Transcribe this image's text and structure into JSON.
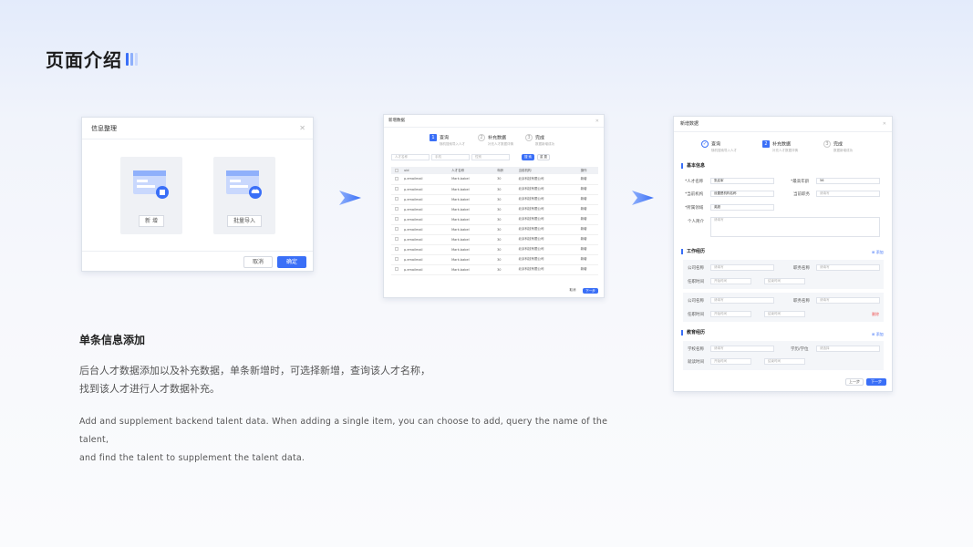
{
  "page": {
    "title": "页面介绍",
    "subtitle": "单条信息添加",
    "desc_cn_1": "后台人才数据添加以及补充数据，单条新增时，可选择新增，查询该人才名称，",
    "desc_cn_2": "找到该人才进行人才数据补充。",
    "desc_en_1": "Add and supplement backend talent data. When adding a single item, you can choose to add, query the name of the talent,",
    "desc_en_2": "and find the talent to supplement the talent data."
  },
  "colors": {
    "accent": "#3a6ff7",
    "bar1": "#3a6ff7",
    "bar2": "#8fb0fb",
    "bar3": "#c9d8fd"
  },
  "dialog1": {
    "title": "信息整理",
    "add_label": "新 增",
    "batch_label": "批量导入",
    "cancel": "取消",
    "confirm": "确定"
  },
  "dialog2": {
    "title": "新增数据",
    "steps": [
      {
        "num": "1",
        "label": "查询",
        "sub": "随机搜索导入人才"
      },
      {
        "num": "2",
        "label": "补充数据",
        "sub": "补充人才数据详情"
      },
      {
        "num": "3",
        "label": "完成",
        "sub": "数据新增成功"
      }
    ],
    "search_placeholders": [
      "人才名称",
      "手机",
      "性别"
    ],
    "search_btn": "搜 索",
    "reset_btn": "重 置",
    "columns": [
      "uid",
      "人才名称",
      "年龄",
      "当前机构",
      "操作"
    ],
    "rows": [
      {
        "uid": "p.emailmail",
        "name": "Mark.babel",
        "age": "30",
        "org": "北京科技有限公司",
        "op": "新增"
      },
      {
        "uid": "p.emailmail",
        "name": "Mark.babel",
        "age": "30",
        "org": "北京科技有限公司",
        "op": "新增"
      },
      {
        "uid": "p.emailmail",
        "name": "Mark.babel",
        "age": "30",
        "org": "北京科技有限公司",
        "op": "新增"
      },
      {
        "uid": "p.emailmail",
        "name": "Mark.babel",
        "age": "30",
        "org": "北京科技有限公司",
        "op": "新增"
      },
      {
        "uid": "p.emailmail",
        "name": "Mark.babel",
        "age": "30",
        "org": "北京科技有限公司",
        "op": "新增"
      },
      {
        "uid": "p.emailmail",
        "name": "Mark.babel",
        "age": "30",
        "org": "北京科技有限公司",
        "op": "新增"
      },
      {
        "uid": "p.emailmail",
        "name": "Mark.babel",
        "age": "30",
        "org": "北京科技有限公司",
        "op": "新增"
      },
      {
        "uid": "p.emailmail",
        "name": "Mark.babel",
        "age": "30",
        "org": "北京科技有限公司",
        "op": "新增"
      },
      {
        "uid": "p.emailmail",
        "name": "Mark.babel",
        "age": "30",
        "org": "北京科技有限公司",
        "op": "新增"
      },
      {
        "uid": "p.emailmail",
        "name": "Mark.babel",
        "age": "30",
        "org": "北京科技有限公司",
        "op": "新增"
      }
    ],
    "cancel": "取消",
    "next": "下一步"
  },
  "dialog3": {
    "title": "新增数据",
    "steps": [
      {
        "num": "✓",
        "label": "查询",
        "sub": "随机搜索导入人才"
      },
      {
        "num": "2",
        "label": "补充数据",
        "sub": "补充人才数据详情"
      },
      {
        "num": "3",
        "label": "完成",
        "sub": "数据新增成功"
      }
    ],
    "basic": {
      "section": "基本信息",
      "name_label": "*人才名称",
      "name_value": "张启军",
      "age_label": "*最高年龄",
      "age_value": "56",
      "org_label": "*当前机构",
      "org_value": "设置是机构名称",
      "title_label": "当前职务",
      "title_placeholder": "请填写",
      "field_label": "*所属领域",
      "field_value": "英超",
      "intro_label": "个人简介",
      "intro_placeholder": "请填写"
    },
    "work": {
      "section": "工作经历",
      "add": "添加",
      "company_label": "公司名称",
      "company_placeholder": "请填写",
      "position_label": "职务名称",
      "position_placeholder": "请填写",
      "time_label": "任职时间",
      "start_placeholder": "开始时间",
      "end_placeholder": "结束时间",
      "delete": "删除"
    },
    "edu": {
      "section": "教育经历",
      "add": "添加",
      "school_label": "学校名称",
      "school_placeholder": "请填写",
      "degree_label": "学历/学位",
      "degree_placeholder": "请选择",
      "time_label": "就读时间",
      "start_placeholder": "开始时间",
      "end_placeholder": "结束时间"
    },
    "prev": "上一步",
    "next": "下一步"
  }
}
